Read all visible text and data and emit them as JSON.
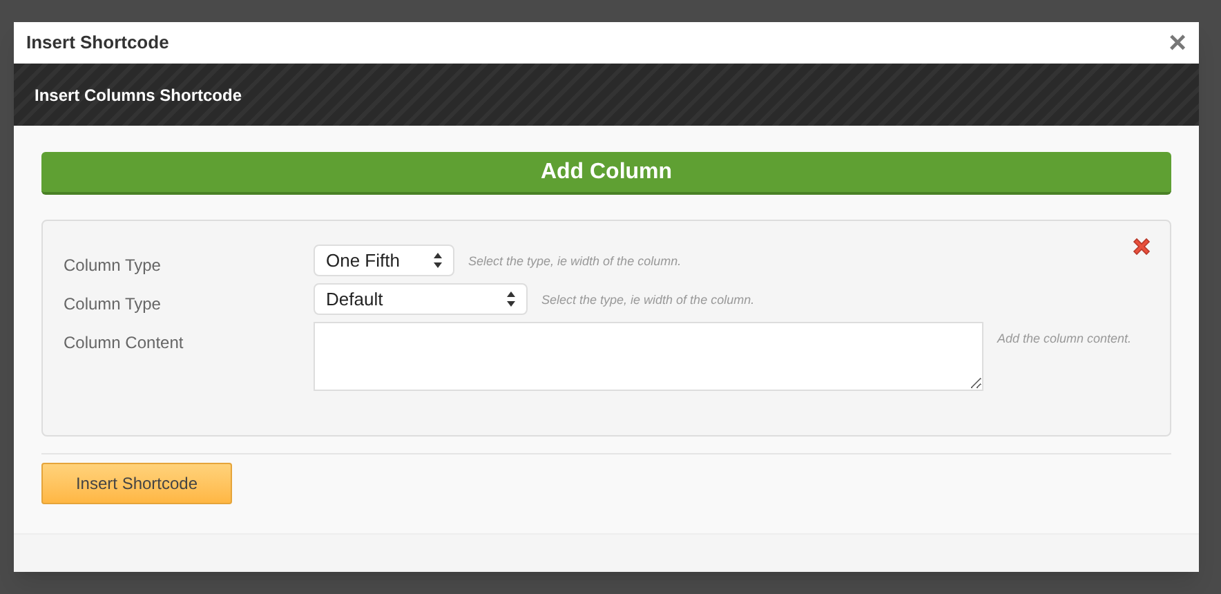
{
  "window": {
    "title": "Insert Shortcode",
    "close": "×"
  },
  "header": {
    "title": "Insert Columns Shortcode"
  },
  "add_button": "Add Column",
  "column_panel": {
    "fields": [
      {
        "kind": "select",
        "label": "Column Type",
        "value": "One Fifth",
        "hint": "Select the type, ie width of the column."
      },
      {
        "kind": "select",
        "label": "Column Type",
        "value": "Default",
        "hint": "Select the type, ie width of the column."
      },
      {
        "kind": "textarea",
        "label": "Column Content",
        "hint": "Add the column content."
      }
    ]
  },
  "submit_button": "Insert Shortcode"
}
